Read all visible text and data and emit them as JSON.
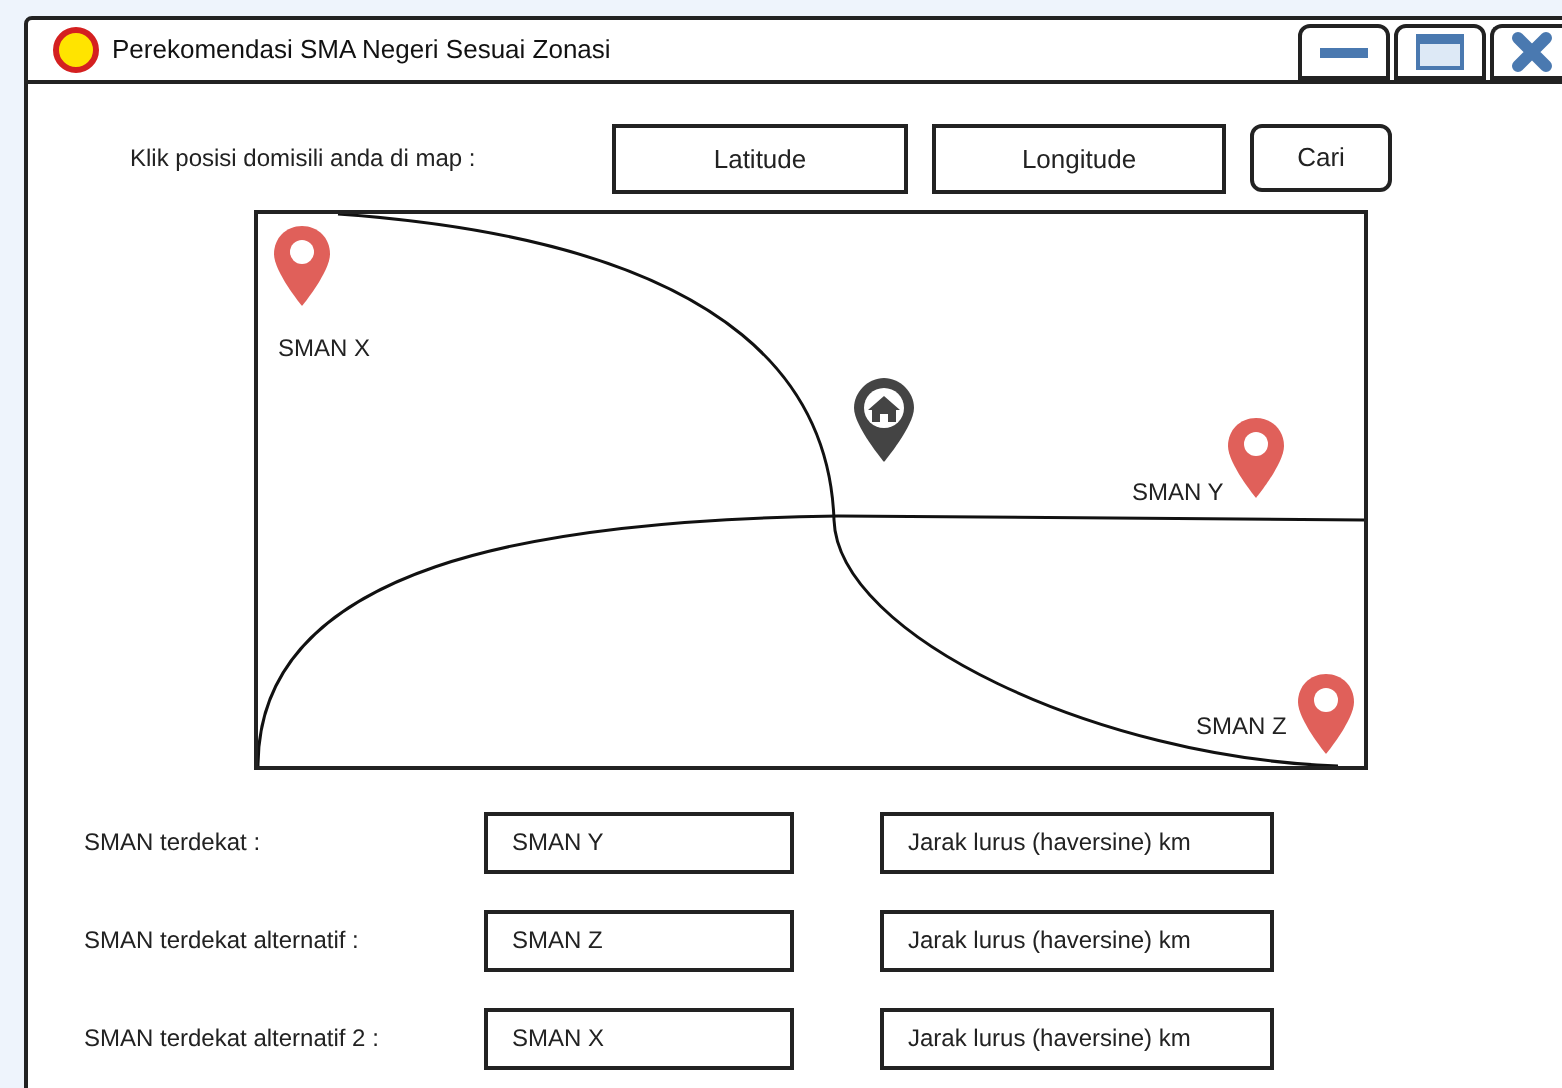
{
  "window": {
    "title": "Perekomendasi SMA Negeri Sesuai Zonasi"
  },
  "search": {
    "label": "Klik posisi domisili anda di map :",
    "latitude": {
      "placeholder": "Latitude"
    },
    "longitude": {
      "placeholder": "Longitude"
    },
    "button": "Cari"
  },
  "map": {
    "markers": [
      {
        "kind": "school",
        "label": "SMAN X"
      },
      {
        "kind": "home"
      },
      {
        "kind": "school",
        "label": "SMAN Y"
      },
      {
        "kind": "school",
        "label": "SMAN Z"
      }
    ]
  },
  "results": [
    {
      "label": "SMAN terdekat :",
      "school": "SMAN Y",
      "distance": "Jarak lurus (haversine) km"
    },
    {
      "label": "SMAN terdekat alternatif :",
      "school": "SMAN Z",
      "distance": "Jarak lurus (haversine) km"
    },
    {
      "label": "SMAN terdekat alternatif 2 :",
      "school": "SMAN X",
      "distance": "Jarak lurus (haversine) km"
    }
  ]
}
